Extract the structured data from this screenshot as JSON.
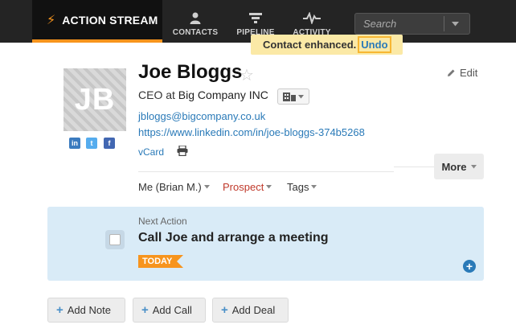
{
  "nav": {
    "active": {
      "label": "ACTION STREAM",
      "icon": "lightning-icon"
    },
    "items": [
      {
        "label": "CONTACTS",
        "icon": "person-icon"
      },
      {
        "label": "PIPELINE",
        "icon": "funnel-icon"
      },
      {
        "label": "ACTIVITY",
        "icon": "pulse-icon"
      }
    ],
    "search_placeholder": "Search"
  },
  "toast": {
    "message": "Contact enhanced.",
    "undo_label": "Undo"
  },
  "contact": {
    "initials": "JB",
    "name": "Joe Bloggs",
    "title_prefix": "CEO at",
    "company": "Big Company INC",
    "email": "jbloggs@bigcompany.co.uk",
    "linkedin_url": "https://www.linkedin.com/in/joe-bloggs-374b5268",
    "vcard_label": "vCard",
    "edit_label": "Edit",
    "more_label": "More",
    "owner": "Me (Brian M.)",
    "stage": "Prospect",
    "tags_label": "Tags",
    "social": [
      {
        "name": "linkedin",
        "glyph": "in",
        "color": "#3b7bbf"
      },
      {
        "name": "twitter",
        "glyph": "t",
        "color": "#55acee"
      },
      {
        "name": "facebook",
        "glyph": "f",
        "color": "#4267b2"
      }
    ]
  },
  "next_action": {
    "label": "Next Action",
    "title": "Call Joe and arrange a meeting",
    "due_badge": "TODAY"
  },
  "buttons": {
    "add_note": "Add Note",
    "add_call": "Add Call",
    "add_deal": "Add Deal"
  },
  "colors": {
    "accent": "#f7941d",
    "link": "#2a7ab8",
    "prospect": "#c0392b",
    "action_panel": "#d9ebf7",
    "toast_bg": "#fbe9a6"
  }
}
